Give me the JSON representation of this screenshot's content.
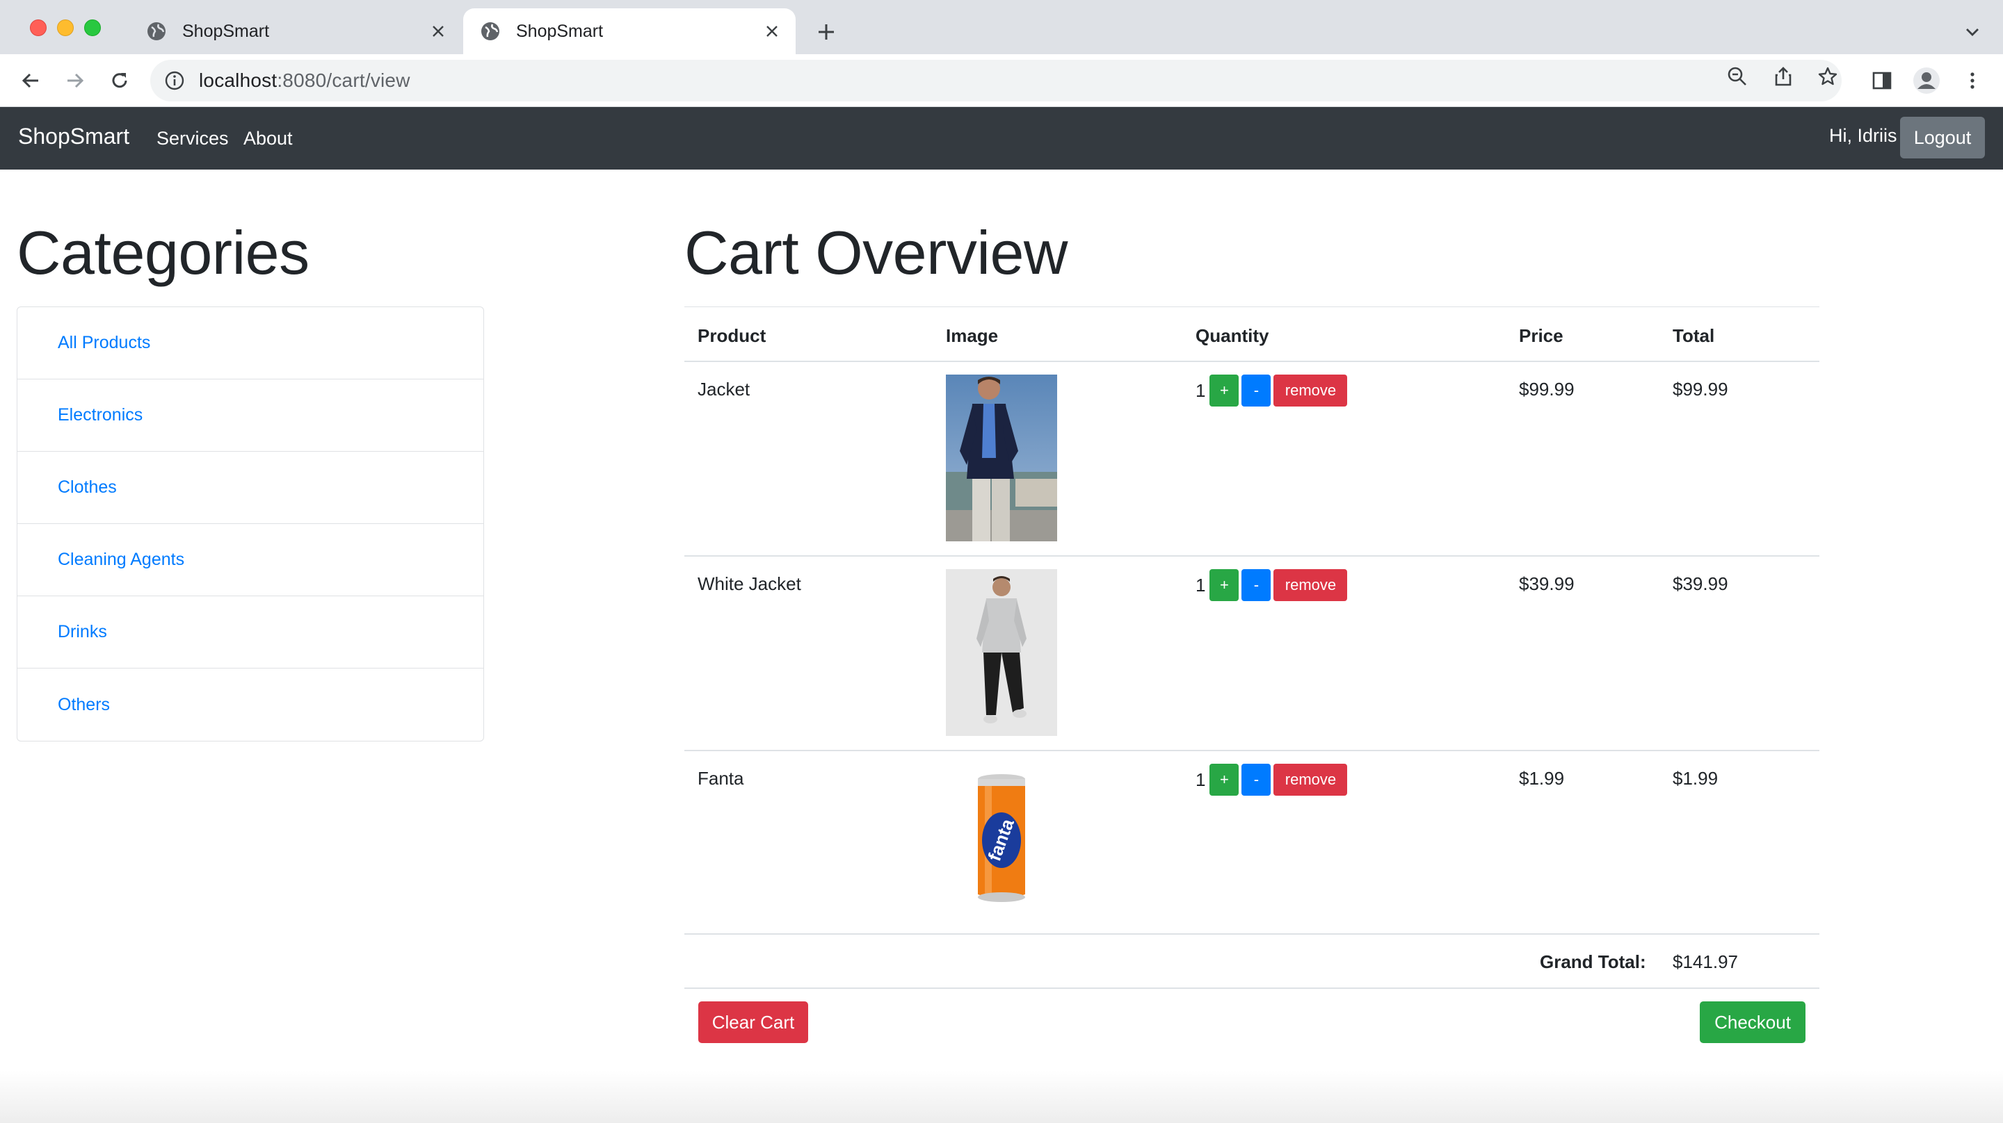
{
  "browser": {
    "tabs": [
      {
        "title": "ShopSmart",
        "active": false
      },
      {
        "title": "ShopSmart",
        "active": true
      }
    ],
    "url_host": "localhost",
    "url_path": ":8080/cart/view"
  },
  "navbar": {
    "brand": "ShopSmart",
    "links": [
      "Services",
      "About"
    ],
    "greeting": "Hi, Idriis",
    "logout_label": "Logout"
  },
  "categories": {
    "heading": "Categories",
    "items": [
      "All Products",
      "Electronics",
      "Clothes",
      "Cleaning Agents",
      "Drinks",
      "Others"
    ]
  },
  "cart": {
    "heading": "Cart Overview",
    "columns": [
      "Product",
      "Image",
      "Quantity",
      "Price",
      "Total"
    ],
    "rows": [
      {
        "product": "Jacket",
        "image": "navy-blazer-photo",
        "quantity": "1",
        "price": "$99.99",
        "total": "$99.99"
      },
      {
        "product": "White Jacket",
        "image": "white-jacket-photo",
        "quantity": "1",
        "price": "$39.99",
        "total": "$39.99"
      },
      {
        "product": "Fanta",
        "image": "fanta-can-photo",
        "quantity": "1",
        "price": "$1.99",
        "total": "$1.99"
      }
    ],
    "plus_label": "+",
    "minus_label": "-",
    "remove_label": "remove",
    "grand_total_label": "Grand Total:",
    "grand_total_value": "$141.97",
    "clear_label": "Clear Cart",
    "checkout_label": "Checkout"
  },
  "colors": {
    "navbar": "#343a40",
    "link": "#007bff",
    "success": "#28a745",
    "danger": "#dc3545",
    "secondary": "#6c757d"
  }
}
